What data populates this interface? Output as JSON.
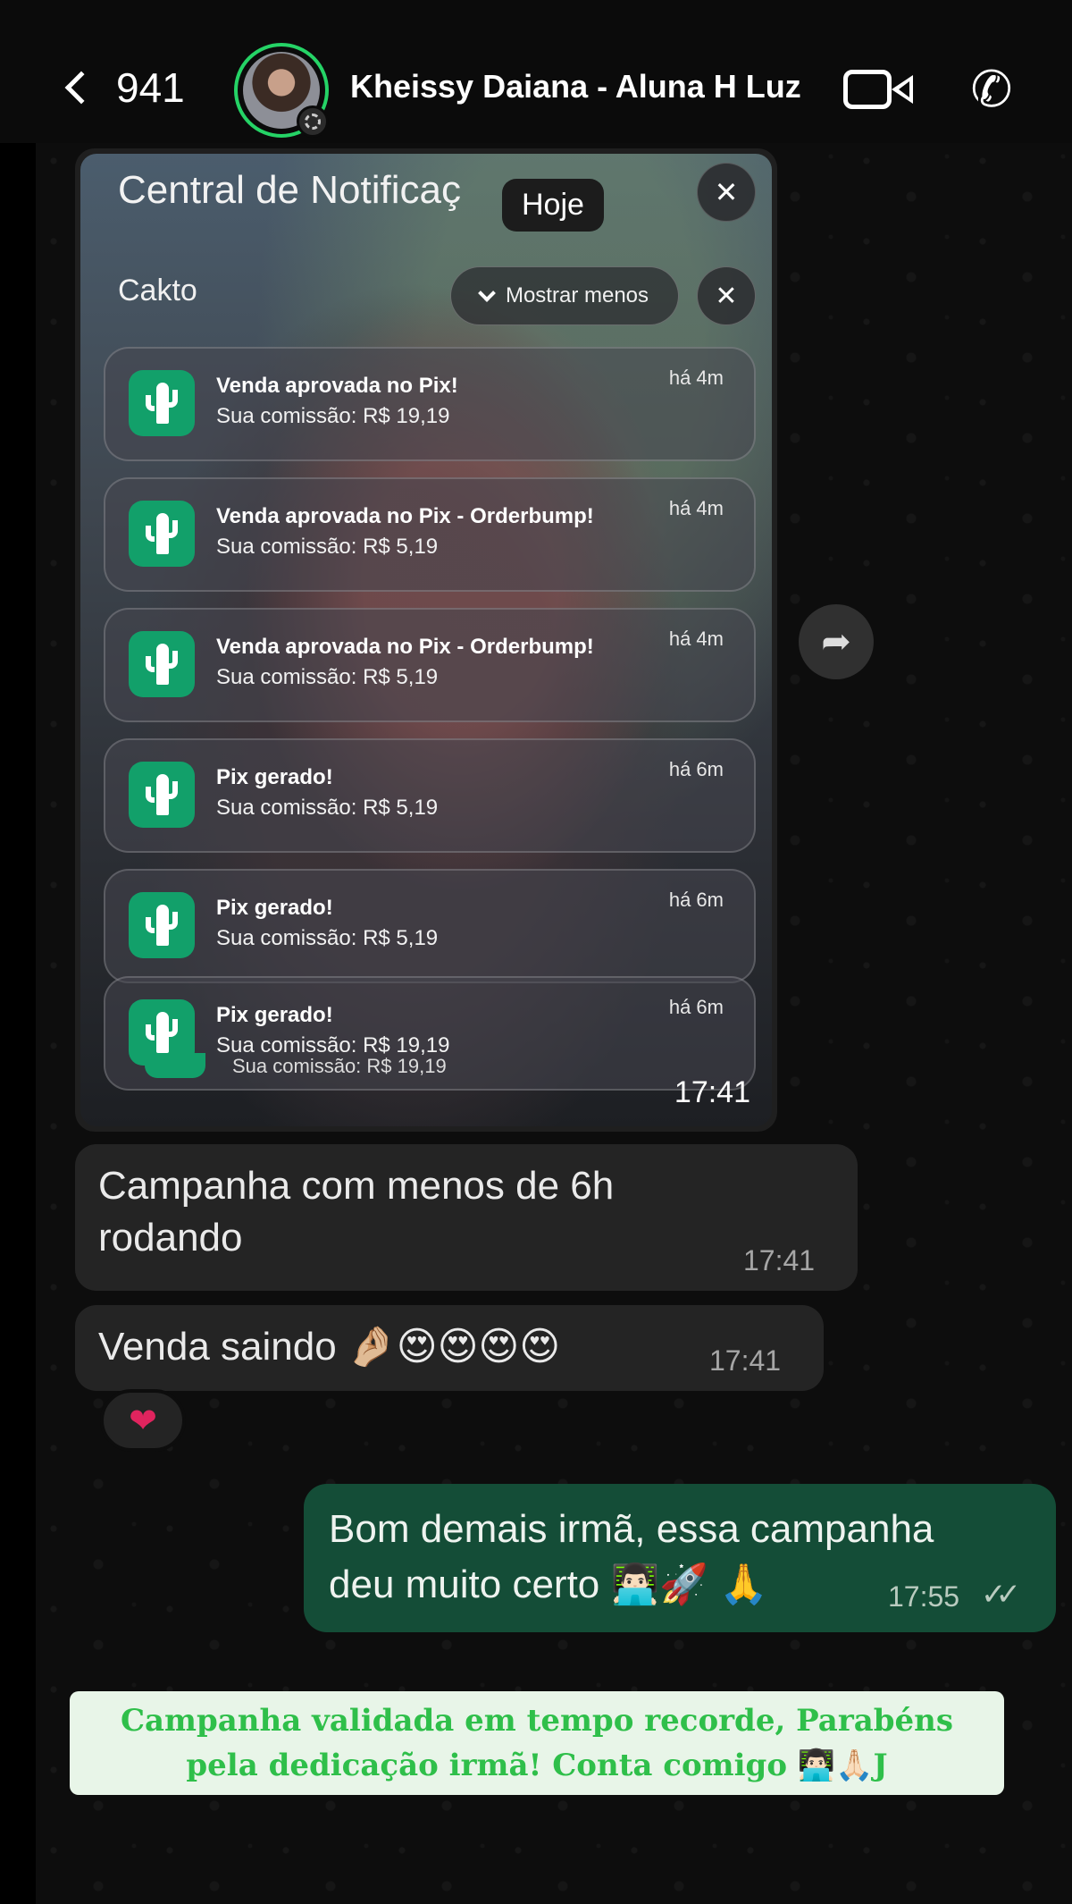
{
  "header": {
    "back_count": "941",
    "contact_name": "Kheissy Daiana - Aluna H Luz"
  },
  "media_message": {
    "date_chip": "Hoje",
    "time": "17:41",
    "screenshot": {
      "title": "Central de Notificaç",
      "close_symbol": "✕",
      "app_name": "Cakto",
      "show_less_label": "Mostrar menos",
      "notifications": [
        {
          "title": "Venda aprovada no Pix!",
          "body": "Sua comissão: R$ 19,19",
          "time": "há 4m"
        },
        {
          "title": "Venda aprovada no Pix - Orderbump!",
          "body": "Sua comissão: R$ 5,19",
          "time": "há 4m"
        },
        {
          "title": "Venda aprovada no Pix - Orderbump!",
          "body": "Sua comissão: R$ 5,19",
          "time": "há 4m"
        },
        {
          "title": "Pix gerado!",
          "body": "Sua comissão: R$ 5,19",
          "time": "há 6m"
        },
        {
          "title": "Pix gerado!",
          "body": "Sua comissão: R$ 5,19",
          "time": "há 6m"
        },
        {
          "title": "Pix gerado!",
          "body": "Sua comissão: R$ 19,19",
          "time": "há 6m"
        }
      ],
      "peek_body": "Sua comissão: R$ 19,19"
    }
  },
  "messages": [
    {
      "direction": "incoming",
      "text_line1": "Campanha com menos de 6h",
      "text_line2": "rodando",
      "time": "17:41"
    },
    {
      "direction": "incoming",
      "text": "Venda saindo 🤌🏼😍😍😍😍",
      "time": "17:41",
      "reaction": "❤"
    },
    {
      "direction": "outgoing",
      "text_line1": "Bom demais irmã, essa campanha",
      "text_line2": "deu muito certo 👨🏻‍💻🚀 🙏",
      "time": "17:55",
      "ticks": "✓✓"
    }
  ],
  "caption": {
    "line1": "Campanha validada em tempo recorde, Parabéns",
    "line2": "pela dedicação irmã! Conta comigo 👨🏻‍💻🙏🏻J"
  },
  "icons": {
    "back": "chevron-left-icon",
    "video": "video-call-icon",
    "call": "phone-icon",
    "forward": "forward-icon",
    "app": "cactus-icon"
  },
  "colors": {
    "accent_green": "#25d366",
    "outgoing_bubble": "#144d37",
    "app_icon": "#12a06a",
    "caption_text": "#2fbf4a",
    "caption_bg": "#e8f5e8"
  }
}
